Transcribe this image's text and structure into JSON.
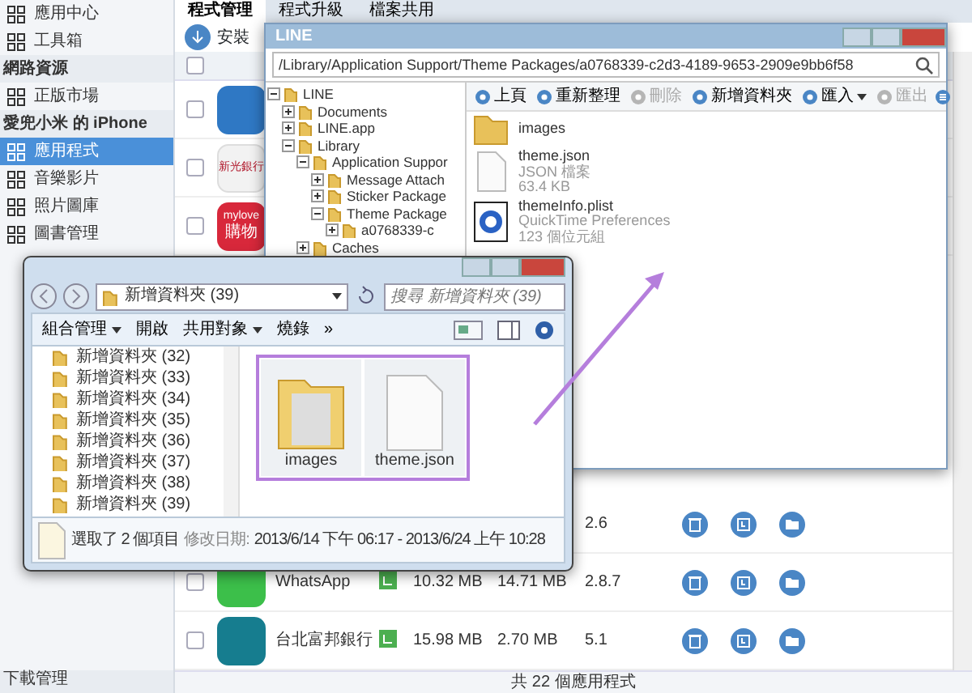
{
  "sidebar": {
    "items": [
      {
        "kind": "item",
        "label": "應用中心",
        "selected": false
      },
      {
        "kind": "item",
        "label": "工具箱",
        "selected": false
      },
      {
        "kind": "header",
        "label": "網路資源"
      },
      {
        "kind": "item",
        "label": "正版市場",
        "selected": false
      },
      {
        "kind": "header",
        "label": "愛兜小米 的 iPhone"
      },
      {
        "kind": "item",
        "label": "應用程式",
        "selected": true
      },
      {
        "kind": "item",
        "label": "音樂影片",
        "selected": false
      },
      {
        "kind": "item",
        "label": "照片圖庫",
        "selected": false
      },
      {
        "kind": "item",
        "label": "圖書管理",
        "selected": false
      }
    ],
    "footer": "下載管理"
  },
  "tabs": [
    {
      "label": "程式管理",
      "selected": true
    },
    {
      "label": "程式升級",
      "selected": false
    },
    {
      "label": "檔案共用",
      "selected": false
    }
  ],
  "toolbar": {
    "install": "安裝"
  },
  "app_list": {
    "select_all": {
      "checked": false
    },
    "rows_top": [
      {
        "checked": false,
        "kind": "cloud"
      },
      {
        "checked": false,
        "kind": "bank",
        "logo_text": "新光銀行"
      },
      {
        "checked": false,
        "kind": "shop",
        "logo_text": "mylove",
        "logo_text_2": "購物"
      }
    ],
    "rows_bottom": [
      {
        "version": "2.6"
      },
      {
        "checked": false,
        "kind": "chat",
        "name": "WhatsApp",
        "size": "10.32 MB",
        "data_size": "14.71 MB",
        "version": "2.8.7"
      },
      {
        "checked": false,
        "kind": "h",
        "name": "台北富邦銀行",
        "size": "15.98 MB",
        "data_size": "2.70 MB",
        "version": "5.1"
      }
    ],
    "footer": "共 22 個應用程式"
  },
  "line_window": {
    "title": "LINE",
    "path": "/Library/Application Support/Theme Packages/a0768339-c2d3-4189-9653-2909e9bb6f58",
    "tree": [
      {
        "label": "LINE",
        "expanded": true,
        "children": [
          {
            "label": "Documents",
            "expanded": false
          },
          {
            "label": "LINE.app",
            "expanded": false
          },
          {
            "label": "Library",
            "expanded": true,
            "children": [
              {
                "label": "Application Suppor",
                "expanded": true,
                "children": [
                  {
                    "label": "Message Attach",
                    "expanded": false
                  },
                  {
                    "label": "Sticker Package",
                    "expanded": false
                  },
                  {
                    "label": "Theme Package",
                    "expanded": true,
                    "children": [
                      {
                        "label": "a0768339-c",
                        "expanded": false
                      }
                    ]
                  }
                ]
              },
              {
                "label": "Caches",
                "expanded": false
              }
            ]
          }
        ]
      }
    ],
    "toolbar": [
      {
        "label": "上頁",
        "disabled": false,
        "dropdown": false
      },
      {
        "label": "重新整理",
        "disabled": false,
        "dropdown": false
      },
      {
        "label": "刪除",
        "disabled": true,
        "dropdown": false
      },
      {
        "label": "新增資料夾",
        "disabled": false,
        "dropdown": false
      },
      {
        "label": "匯入",
        "disabled": false,
        "dropdown": true
      },
      {
        "label": "匯出",
        "disabled": true,
        "dropdown": false
      }
    ],
    "files": [
      {
        "kind": "folder",
        "name": "images"
      },
      {
        "kind": "file",
        "name": "theme.json",
        "type": "JSON 檔案",
        "size": "63.4 KB"
      },
      {
        "kind": "plist",
        "name": "themeInfo.plist",
        "type": "QuickTime Preferences",
        "size": "123 個位元組"
      }
    ]
  },
  "explorer_window": {
    "breadcrumb": "新增資料夾 (39)",
    "search": {
      "placeholder": "搜尋 新增資料夾 (39)"
    },
    "toolbar": [
      {
        "label": "組合管理",
        "dropdown": true
      },
      {
        "label": "開啟",
        "dropdown": false
      },
      {
        "label": "共用對象",
        "dropdown": true
      },
      {
        "label": "燒錄",
        "dropdown": false
      },
      {
        "label": "»",
        "dropdown": false
      }
    ],
    "nav": [
      "新增資料夾 (32)",
      "新增資料夾 (33)",
      "新增資料夾 (34)",
      "新增資料夾 (35)",
      "新增資料夾 (36)",
      "新增資料夾 (37)",
      "新增資料夾 (38)",
      "新增資料夾 (39)"
    ],
    "items": [
      {
        "kind": "folder",
        "name": "images",
        "selected": true
      },
      {
        "kind": "file",
        "name": "theme.json",
        "selected": true
      }
    ],
    "status": {
      "selection": "選取了 2 個項目",
      "date_label": "修改日期:",
      "date_range": "2013/6/14 下午 06:17 - 2013/6/24 上午 10:28"
    }
  }
}
